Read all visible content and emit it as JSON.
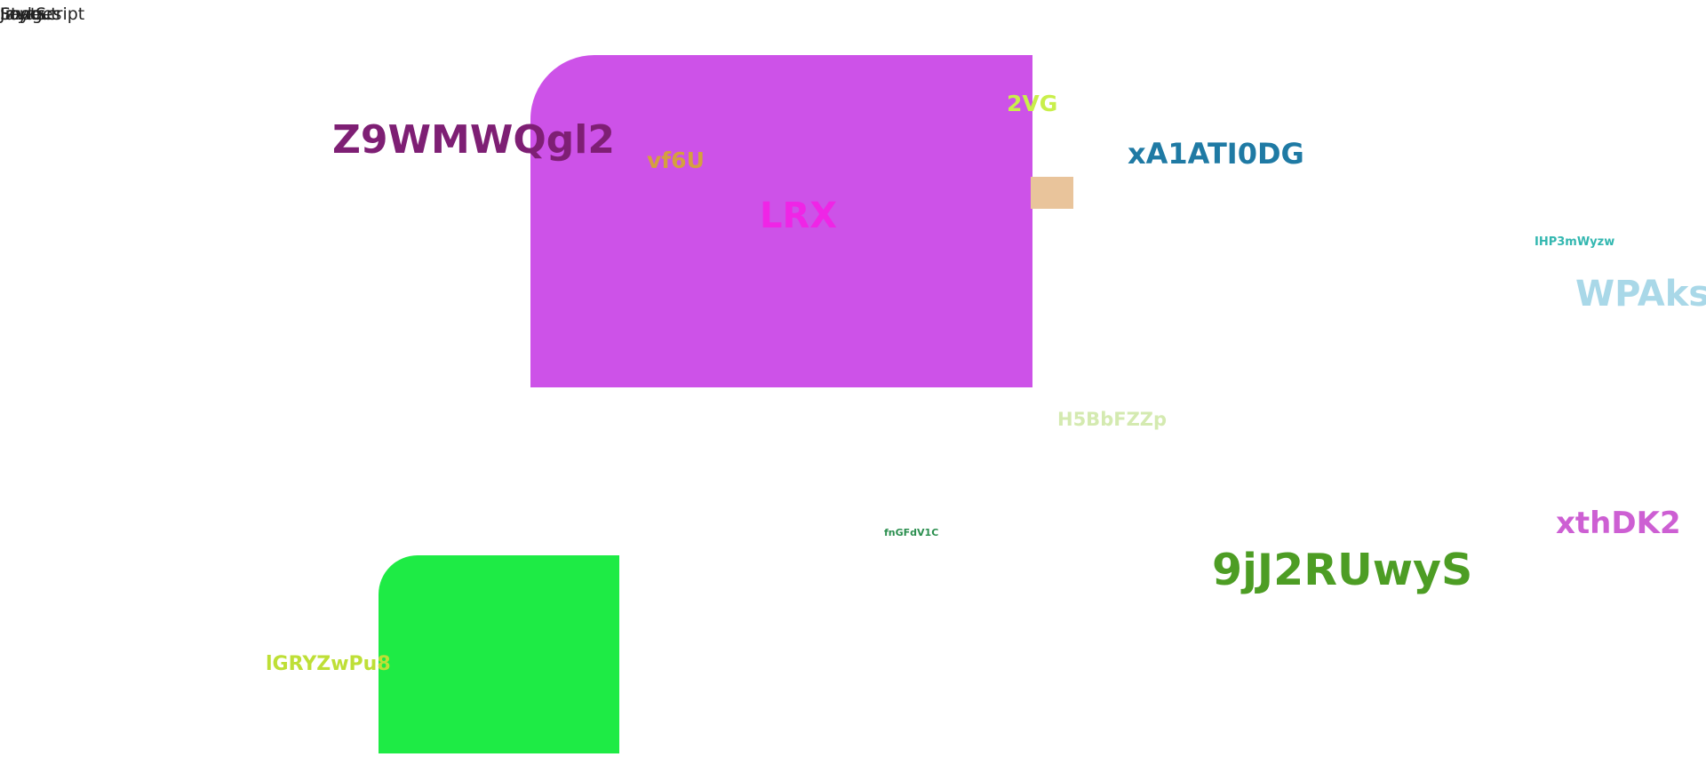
{
  "corner_labels": [
    "JavaScript",
    "Images",
    "Fonts",
    "Style",
    "Layout"
  ],
  "texts": {
    "z9wmwqgl2": "Z9WMWQgl2",
    "vf6u": "vf6U",
    "twovg": "2VG",
    "lrx": "LRX",
    "xa1ati0dg": "xA1ATI0DG",
    "ihp3mwyzw": "IHP3mWyzw",
    "wpaks": "WPAksU",
    "h5bbfzzp": "H5BbFZZp",
    "fngfdv1c": "fnGFdV1C",
    "nine_jj": "9jJ2RUwyS",
    "xthdk2": "xthDK2",
    "igryzwpu8": "lGRYZwPu8"
  },
  "colors": {
    "magenta_block": "#cd52e8",
    "tan_block": "#e9c49b",
    "green_block": "#1eeb45"
  }
}
